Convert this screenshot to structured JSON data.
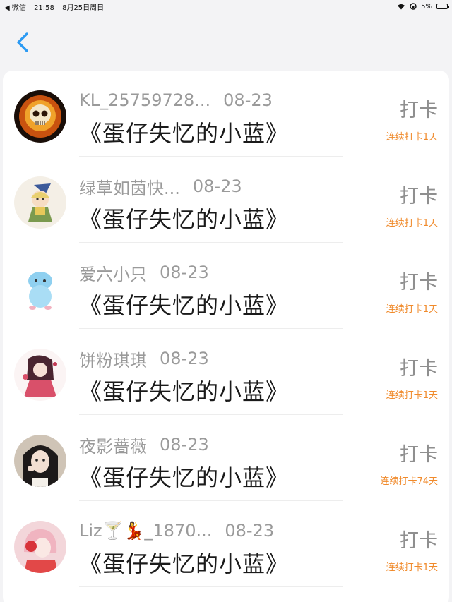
{
  "status_bar": {
    "carrier": "◀ 微信",
    "time": "21:58",
    "date": "8月25日周日",
    "battery": "5%"
  },
  "nav": {
    "back_icon": "chevron-left-icon"
  },
  "colors": {
    "accent": "#2b9af3",
    "streak": "#f08a2b"
  },
  "rows": [
    {
      "name": "KL_25759728...",
      "date": "08-23",
      "title": "《蛋仔失忆的小蓝》",
      "checkin": "打卡",
      "streak": "连续打卡1天",
      "avatar": "skull-avatar"
    },
    {
      "name": "绿草如茵快...",
      "date": "08-23",
      "title": "《蛋仔失忆的小蓝》",
      "checkin": "打卡",
      "streak": "连续打卡1天",
      "avatar": "wizard-avatar"
    },
    {
      "name": "爱六小只",
      "date": "08-23",
      "title": "《蛋仔失忆的小蓝》",
      "checkin": "打卡",
      "streak": "连续打卡1天",
      "avatar": "blue-bunny-avatar"
    },
    {
      "name": "饼粉琪琪",
      "date": "08-23",
      "title": "《蛋仔失忆的小蓝》",
      "checkin": "打卡",
      "streak": "连续打卡1天",
      "avatar": "anime-girl-avatar"
    },
    {
      "name": "夜影蔷薇",
      "date": "08-23",
      "title": "《蛋仔失忆的小蓝》",
      "checkin": "打卡",
      "streak": "连续打卡74天",
      "avatar": "photo-girl-avatar"
    },
    {
      "name": "Liz🍸💃_1870...",
      "date": "08-23",
      "title": "《蛋仔失忆的小蓝》",
      "checkin": "打卡",
      "streak": "连续打卡1天",
      "avatar": "pink-hair-avatar"
    }
  ]
}
